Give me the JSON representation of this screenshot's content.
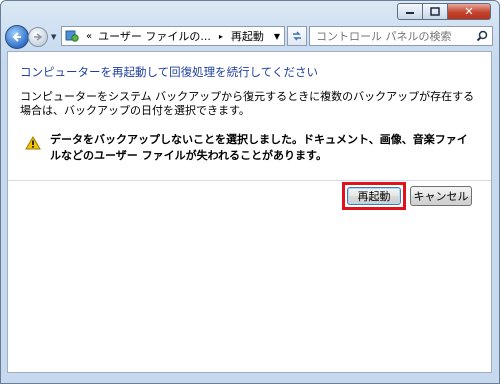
{
  "window": {
    "caption_buttons": {
      "minimize_icon": "minimize-icon",
      "maximize_icon": "maximize-icon",
      "close_label": "✕"
    }
  },
  "toolbar": {
    "address": {
      "overflow": "«",
      "segments": [
        "ユーザー ファイルの...",
        "再起動"
      ],
      "separator": "▸"
    },
    "search": {
      "placeholder": "コントロール パネルの検索"
    }
  },
  "main": {
    "heading": "コンピューターを再起動して回復処理を続行してください",
    "description": "コンピューターをシステム バックアップから復元するときに複数のバックアップが存在する場合は、バックアップの日付を選択できます。",
    "warning": "データをバックアップしないことを選択しました。ドキュメント、画像、音楽ファイルなどのユーザー ファイルが失われることがあります。",
    "buttons": {
      "restart": "再起動",
      "cancel": "キャンセル"
    }
  },
  "colors": {
    "heading": "#1e3fa0",
    "highlight_frame": "#e0121b",
    "close_button": "#c2442f"
  }
}
